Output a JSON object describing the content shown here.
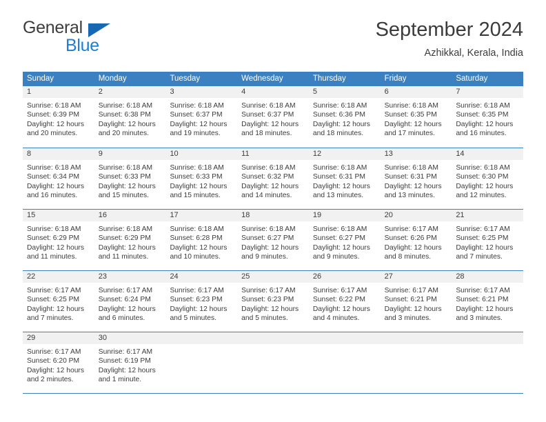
{
  "brand": {
    "name_top": "General",
    "name_bottom": "Blue",
    "triangle_color": "#1668b3",
    "blue_color": "#1a7fd4"
  },
  "header": {
    "month_title": "September 2024",
    "location": "Azhikkal, Kerala, India"
  },
  "theme": {
    "header_blue": "#3b80c0",
    "date_band": "#f1f1f1",
    "text": "#3b3b3b"
  },
  "calendar": {
    "day_headers": [
      "Sunday",
      "Monday",
      "Tuesday",
      "Wednesday",
      "Thursday",
      "Friday",
      "Saturday"
    ],
    "weeks": [
      [
        {
          "day": "1",
          "sunrise": "Sunrise: 6:18 AM",
          "sunset": "Sunset: 6:39 PM",
          "daylight_1": "Daylight: 12 hours",
          "daylight_2": "and 20 minutes."
        },
        {
          "day": "2",
          "sunrise": "Sunrise: 6:18 AM",
          "sunset": "Sunset: 6:38 PM",
          "daylight_1": "Daylight: 12 hours",
          "daylight_2": "and 20 minutes."
        },
        {
          "day": "3",
          "sunrise": "Sunrise: 6:18 AM",
          "sunset": "Sunset: 6:37 PM",
          "daylight_1": "Daylight: 12 hours",
          "daylight_2": "and 19 minutes."
        },
        {
          "day": "4",
          "sunrise": "Sunrise: 6:18 AM",
          "sunset": "Sunset: 6:37 PM",
          "daylight_1": "Daylight: 12 hours",
          "daylight_2": "and 18 minutes."
        },
        {
          "day": "5",
          "sunrise": "Sunrise: 6:18 AM",
          "sunset": "Sunset: 6:36 PM",
          "daylight_1": "Daylight: 12 hours",
          "daylight_2": "and 18 minutes."
        },
        {
          "day": "6",
          "sunrise": "Sunrise: 6:18 AM",
          "sunset": "Sunset: 6:35 PM",
          "daylight_1": "Daylight: 12 hours",
          "daylight_2": "and 17 minutes."
        },
        {
          "day": "7",
          "sunrise": "Sunrise: 6:18 AM",
          "sunset": "Sunset: 6:35 PM",
          "daylight_1": "Daylight: 12 hours",
          "daylight_2": "and 16 minutes."
        }
      ],
      [
        {
          "day": "8",
          "sunrise": "Sunrise: 6:18 AM",
          "sunset": "Sunset: 6:34 PM",
          "daylight_1": "Daylight: 12 hours",
          "daylight_2": "and 16 minutes."
        },
        {
          "day": "9",
          "sunrise": "Sunrise: 6:18 AM",
          "sunset": "Sunset: 6:33 PM",
          "daylight_1": "Daylight: 12 hours",
          "daylight_2": "and 15 minutes."
        },
        {
          "day": "10",
          "sunrise": "Sunrise: 6:18 AM",
          "sunset": "Sunset: 6:33 PM",
          "daylight_1": "Daylight: 12 hours",
          "daylight_2": "and 15 minutes."
        },
        {
          "day": "11",
          "sunrise": "Sunrise: 6:18 AM",
          "sunset": "Sunset: 6:32 PM",
          "daylight_1": "Daylight: 12 hours",
          "daylight_2": "and 14 minutes."
        },
        {
          "day": "12",
          "sunrise": "Sunrise: 6:18 AM",
          "sunset": "Sunset: 6:31 PM",
          "daylight_1": "Daylight: 12 hours",
          "daylight_2": "and 13 minutes."
        },
        {
          "day": "13",
          "sunrise": "Sunrise: 6:18 AM",
          "sunset": "Sunset: 6:31 PM",
          "daylight_1": "Daylight: 12 hours",
          "daylight_2": "and 13 minutes."
        },
        {
          "day": "14",
          "sunrise": "Sunrise: 6:18 AM",
          "sunset": "Sunset: 6:30 PM",
          "daylight_1": "Daylight: 12 hours",
          "daylight_2": "and 12 minutes."
        }
      ],
      [
        {
          "day": "15",
          "sunrise": "Sunrise: 6:18 AM",
          "sunset": "Sunset: 6:29 PM",
          "daylight_1": "Daylight: 12 hours",
          "daylight_2": "and 11 minutes."
        },
        {
          "day": "16",
          "sunrise": "Sunrise: 6:18 AM",
          "sunset": "Sunset: 6:29 PM",
          "daylight_1": "Daylight: 12 hours",
          "daylight_2": "and 11 minutes."
        },
        {
          "day": "17",
          "sunrise": "Sunrise: 6:18 AM",
          "sunset": "Sunset: 6:28 PM",
          "daylight_1": "Daylight: 12 hours",
          "daylight_2": "and 10 minutes."
        },
        {
          "day": "18",
          "sunrise": "Sunrise: 6:18 AM",
          "sunset": "Sunset: 6:27 PM",
          "daylight_1": "Daylight: 12 hours",
          "daylight_2": "and 9 minutes."
        },
        {
          "day": "19",
          "sunrise": "Sunrise: 6:18 AM",
          "sunset": "Sunset: 6:27 PM",
          "daylight_1": "Daylight: 12 hours",
          "daylight_2": "and 9 minutes."
        },
        {
          "day": "20",
          "sunrise": "Sunrise: 6:17 AM",
          "sunset": "Sunset: 6:26 PM",
          "daylight_1": "Daylight: 12 hours",
          "daylight_2": "and 8 minutes."
        },
        {
          "day": "21",
          "sunrise": "Sunrise: 6:17 AM",
          "sunset": "Sunset: 6:25 PM",
          "daylight_1": "Daylight: 12 hours",
          "daylight_2": "and 7 minutes."
        }
      ],
      [
        {
          "day": "22",
          "sunrise": "Sunrise: 6:17 AM",
          "sunset": "Sunset: 6:25 PM",
          "daylight_1": "Daylight: 12 hours",
          "daylight_2": "and 7 minutes."
        },
        {
          "day": "23",
          "sunrise": "Sunrise: 6:17 AM",
          "sunset": "Sunset: 6:24 PM",
          "daylight_1": "Daylight: 12 hours",
          "daylight_2": "and 6 minutes."
        },
        {
          "day": "24",
          "sunrise": "Sunrise: 6:17 AM",
          "sunset": "Sunset: 6:23 PM",
          "daylight_1": "Daylight: 12 hours",
          "daylight_2": "and 5 minutes."
        },
        {
          "day": "25",
          "sunrise": "Sunrise: 6:17 AM",
          "sunset": "Sunset: 6:23 PM",
          "daylight_1": "Daylight: 12 hours",
          "daylight_2": "and 5 minutes."
        },
        {
          "day": "26",
          "sunrise": "Sunrise: 6:17 AM",
          "sunset": "Sunset: 6:22 PM",
          "daylight_1": "Daylight: 12 hours",
          "daylight_2": "and 4 minutes."
        },
        {
          "day": "27",
          "sunrise": "Sunrise: 6:17 AM",
          "sunset": "Sunset: 6:21 PM",
          "daylight_1": "Daylight: 12 hours",
          "daylight_2": "and 3 minutes."
        },
        {
          "day": "28",
          "sunrise": "Sunrise: 6:17 AM",
          "sunset": "Sunset: 6:21 PM",
          "daylight_1": "Daylight: 12 hours",
          "daylight_2": "and 3 minutes."
        }
      ],
      [
        {
          "day": "29",
          "sunrise": "Sunrise: 6:17 AM",
          "sunset": "Sunset: 6:20 PM",
          "daylight_1": "Daylight: 12 hours",
          "daylight_2": "and 2 minutes."
        },
        {
          "day": "30",
          "sunrise": "Sunrise: 6:17 AM",
          "sunset": "Sunset: 6:19 PM",
          "daylight_1": "Daylight: 12 hours",
          "daylight_2": "and 1 minute."
        },
        {
          "day": "",
          "sunrise": "",
          "sunset": "",
          "daylight_1": "",
          "daylight_2": ""
        },
        {
          "day": "",
          "sunrise": "",
          "sunset": "",
          "daylight_1": "",
          "daylight_2": ""
        },
        {
          "day": "",
          "sunrise": "",
          "sunset": "",
          "daylight_1": "",
          "daylight_2": ""
        },
        {
          "day": "",
          "sunrise": "",
          "sunset": "",
          "daylight_1": "",
          "daylight_2": ""
        },
        {
          "day": "",
          "sunrise": "",
          "sunset": "",
          "daylight_1": "",
          "daylight_2": ""
        }
      ]
    ]
  }
}
